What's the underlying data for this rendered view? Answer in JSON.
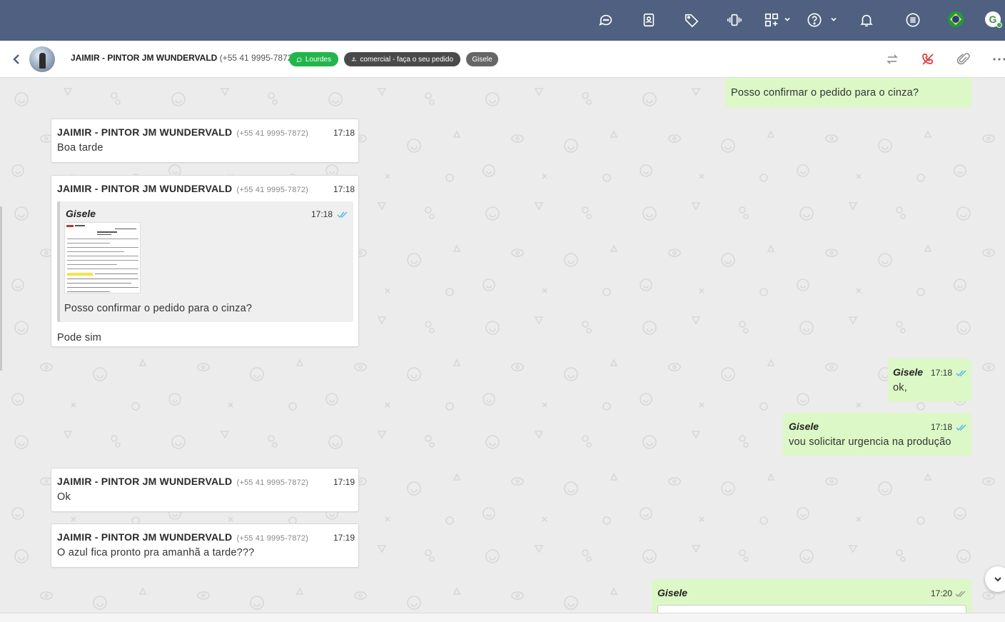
{
  "topbar": {
    "icons": [
      "chat-bubbles-icon",
      "contacts-book-icon",
      "tag-icon",
      "vibrate-phone-icon",
      "apps-grid-icon",
      "help-icon",
      "bell-icon",
      "menu-list-icon"
    ],
    "language_flag": "brazil-flag-icon",
    "user_initial": "G",
    "bg_color": "#4f6080"
  },
  "chat_header": {
    "contact_name": "JAIMIR - PINTOR JM WUNDERVALD",
    "contact_phone": "(+55 41 9995-7872)",
    "tags": [
      {
        "label": "Lourdes",
        "color": "#21b54c",
        "icon": "whatsapp-icon"
      },
      {
        "label": "comercial - faça o seu pedido",
        "color": "#4a4a4a",
        "icon": "department-icon"
      },
      {
        "label": "Gisele",
        "color": "#666666"
      }
    ]
  },
  "messages": {
    "top_out": {
      "text": "Posso confirmar o pedido para o cinza?"
    },
    "m1": {
      "sender": "JAIMIR - PINTOR JM WUNDERVALD",
      "phone": "(+55 41 9995-7872)",
      "time": "17:18",
      "text": "Boa tarde"
    },
    "m2": {
      "sender": "JAIMIR - PINTOR JM WUNDERVALD",
      "phone": "(+55 41 9995-7872)",
      "time": "17:18",
      "quote": {
        "agent": "Gisele",
        "time": "17:18",
        "text": "Posso confirmar o pedido para o cinza?"
      },
      "text": "Pode sim"
    },
    "m3": {
      "agent": "Gisele",
      "time": "17:18",
      "text": "ok,"
    },
    "m4": {
      "agent": "Gisele",
      "time": "17:18",
      "text": "vou solicitar urgencia na produção"
    },
    "m5": {
      "sender": "JAIMIR - PINTOR JM WUNDERVALD",
      "phone": "(+55 41 9995-7872)",
      "time": "17:19",
      "text": "Ok"
    },
    "m6": {
      "sender": "JAIMIR - PINTOR JM WUNDERVALD",
      "phone": "(+55 41 9995-7872)",
      "time": "17:19",
      "text": "O azul fica pronto pra amanhã a tarde???"
    },
    "m7": {
      "agent": "Gisele",
      "time": "17:20"
    }
  },
  "colors": {
    "incoming": "#ffffff",
    "outgoing": "#dcf8c6",
    "tick_blue": "#4fb6ec"
  }
}
